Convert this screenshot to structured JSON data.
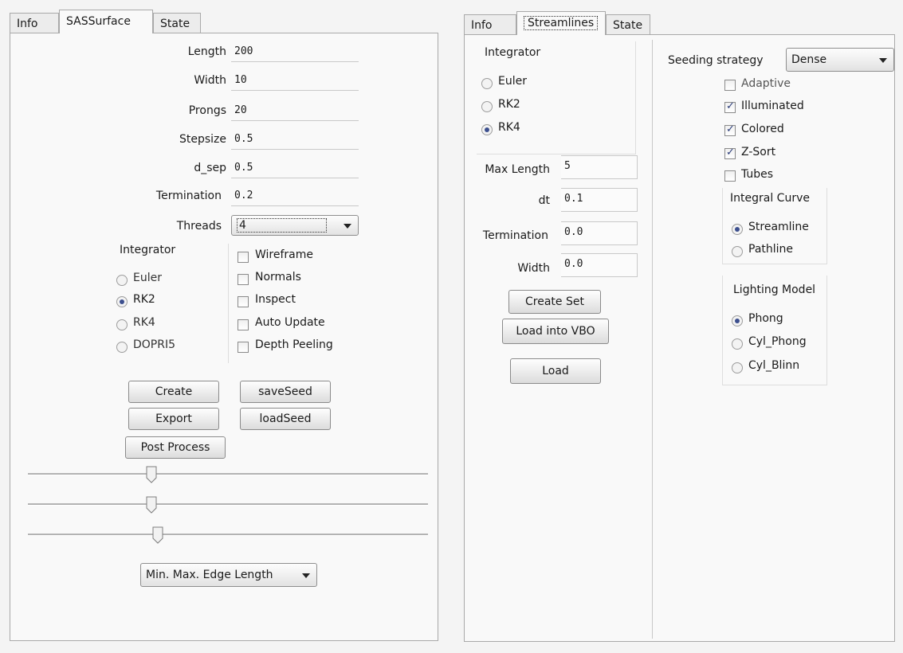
{
  "left": {
    "tabs": [
      {
        "label": "Info"
      },
      {
        "label": "SASSurface"
      },
      {
        "label": "State"
      }
    ],
    "params": [
      {
        "label": "Length",
        "value": "200"
      },
      {
        "label": "Width",
        "value": "10"
      },
      {
        "label": "Prongs",
        "value": "20"
      },
      {
        "label": "Stepsize",
        "value": "0.5"
      },
      {
        "label": "d_sep",
        "value": "0.5"
      },
      {
        "label": "Termination",
        "value": "0.2"
      }
    ],
    "threads": {
      "label": "Threads",
      "value": "4"
    },
    "integrator": {
      "title": "Integrator",
      "options": [
        {
          "label": "Euler",
          "selected": false
        },
        {
          "label": "RK2",
          "selected": true
        },
        {
          "label": "RK4",
          "selected": false
        },
        {
          "label": "DOPRI5",
          "selected": false
        }
      ]
    },
    "checkboxes": [
      {
        "label": "Wireframe",
        "checked": false
      },
      {
        "label": "Normals",
        "checked": false
      },
      {
        "label": "Inspect",
        "checked": false
      },
      {
        "label": "Auto Update",
        "checked": false
      },
      {
        "label": "Depth Peeling",
        "checked": false
      }
    ],
    "buttons": {
      "create": "Create",
      "save_seed": "saveSeed",
      "export": "Export",
      "load_seed": "loadSeed",
      "post_process": "Post Process"
    },
    "sliders": [
      0.3,
      0.3,
      0.32
    ],
    "edge_combo": "Min. Max. Edge Length"
  },
  "right": {
    "tabs": [
      {
        "label": "Info"
      },
      {
        "label": "Streamlines"
      },
      {
        "label": "State"
      }
    ],
    "integrator": {
      "title": "Integrator",
      "options": [
        {
          "label": "Euler",
          "selected": false
        },
        {
          "label": "RK2",
          "selected": false
        },
        {
          "label": "RK4",
          "selected": true
        }
      ]
    },
    "params": [
      {
        "label": "Max Length",
        "value": "5"
      },
      {
        "label": "dt",
        "value": "0.1"
      },
      {
        "label": "Termination",
        "value": "0.0"
      },
      {
        "label": "Width",
        "value": "0.0"
      }
    ],
    "buttons": {
      "create_set": "Create Set",
      "load_vbo": "Load into VBO",
      "load": "Load"
    },
    "seeding": {
      "label": "Seeding strategy",
      "value": "Dense"
    },
    "checkboxes": [
      {
        "label": "Adaptive",
        "checked": false
      },
      {
        "label": "Illuminated",
        "checked": true
      },
      {
        "label": "Colored",
        "checked": true
      },
      {
        "label": "Z-Sort",
        "checked": true
      },
      {
        "label": "Tubes",
        "checked": false
      }
    ],
    "integral_curve": {
      "title": "Integral Curve",
      "options": [
        {
          "label": "Streamline",
          "selected": true
        },
        {
          "label": "Pathline",
          "selected": false
        }
      ]
    },
    "lighting": {
      "title": "Lighting Model",
      "options": [
        {
          "label": "Phong",
          "selected": true
        },
        {
          "label": "Cyl_Phong",
          "selected": false
        },
        {
          "label": "Cyl_Blinn",
          "selected": false
        }
      ]
    }
  },
  "colors": {
    "radio_dot": "#3c4f8e",
    "check_mark": "#2c3d7a"
  }
}
